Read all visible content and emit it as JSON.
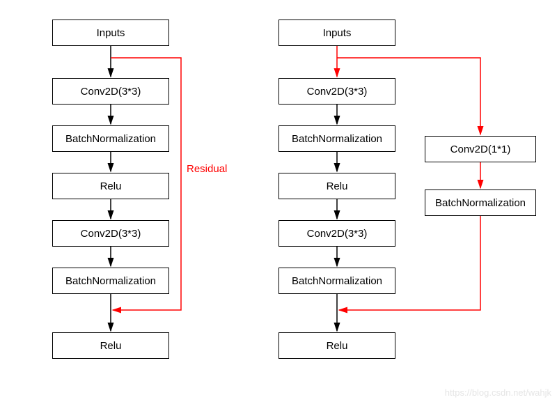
{
  "left": {
    "inputs": "Inputs",
    "conv1": "Conv2D(3*3)",
    "bn1": "BatchNormalization",
    "relu1": "Relu",
    "conv2": "Conv2D(3*3)",
    "bn2": "BatchNormalization",
    "relu2": "Relu",
    "residual_label": "Residual"
  },
  "right": {
    "inputs": "Inputs",
    "conv1": "Conv2D(3*3)",
    "bn1": "BatchNormalization",
    "relu1": "Relu",
    "conv2": "Conv2D(3*3)",
    "bn2": "BatchNormalization",
    "relu2": "Relu",
    "shortcut_conv": "Conv2D(1*1)",
    "shortcut_bn": "BatchNormalization"
  },
  "watermark": "https://blog.csdn.net/wahjk"
}
